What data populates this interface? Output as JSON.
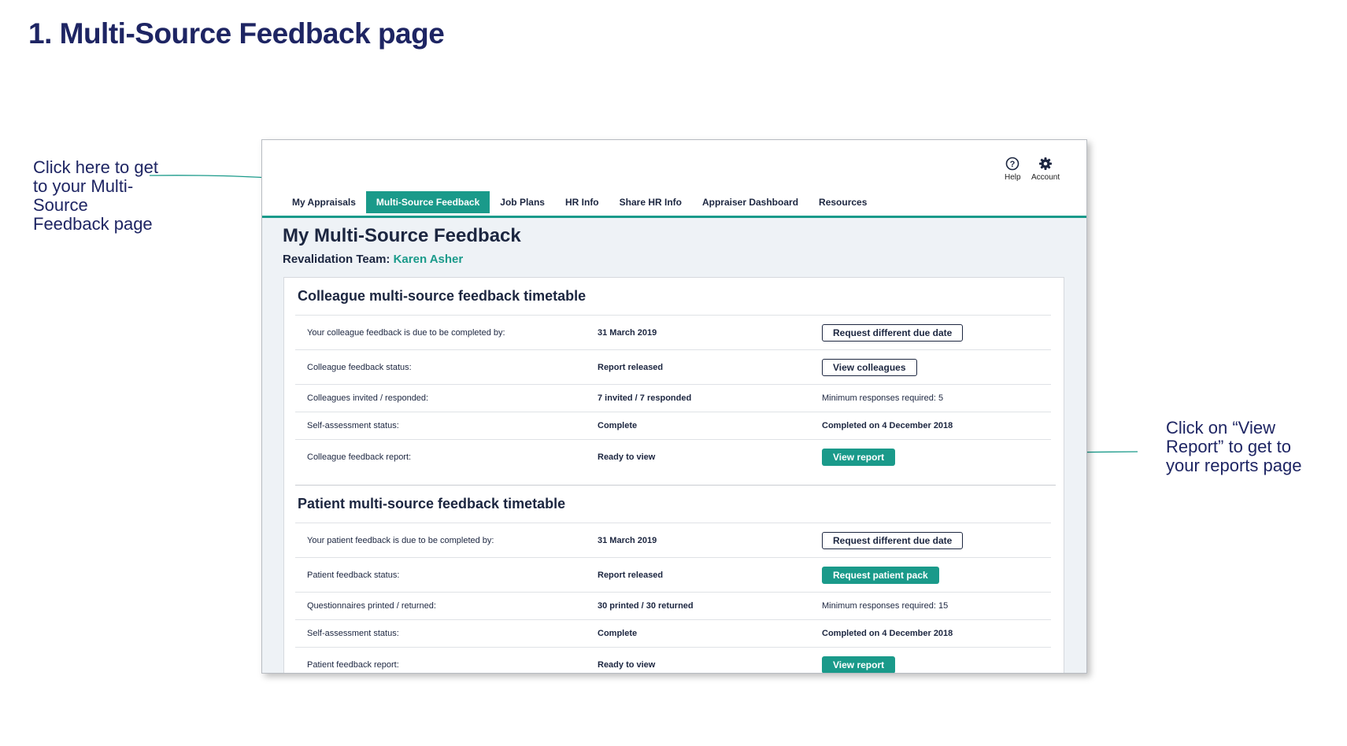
{
  "slide_title": "1. Multi-Source Feedback page",
  "annotations": {
    "left": "Click here to get to your Multi-Source Feedback page",
    "right": "Click on “View Report” to get to your reports page"
  },
  "colors": {
    "brand_teal": "#1a9a8a",
    "navy": "#1e2563"
  },
  "utility": {
    "help_label": "Help",
    "help_icon": "help-circle-icon",
    "account_label": "Account",
    "account_icon": "gear-icon"
  },
  "tabs": [
    {
      "label": "My Appraisals"
    },
    {
      "label": "Multi-Source Feedback",
      "active": true
    },
    {
      "label": "Job Plans"
    },
    {
      "label": "HR Info"
    },
    {
      "label": "Share HR Info"
    },
    {
      "label": "Appraiser Dashboard"
    },
    {
      "label": "Resources"
    }
  ],
  "page": {
    "heading": "My Multi-Source Feedback",
    "team_label": "Revalidation Team:",
    "team_name": "Karen Asher"
  },
  "colleague": {
    "heading": "Colleague multi-source feedback timetable",
    "rows": [
      {
        "label": "Your colleague feedback is due to be completed by:",
        "value": "31 March 2019",
        "action": "Request different due date"
      },
      {
        "label": "Colleague feedback status:",
        "value": "Report released",
        "action": "View colleagues"
      },
      {
        "label": "Colleagues invited / responded:",
        "value": "7 invited / 7 responded",
        "note": "Minimum responses required: 5"
      },
      {
        "label": "Self-assessment status:",
        "value": "Complete",
        "note": "Completed on 4 December 2018"
      },
      {
        "label": "Colleague feedback report:",
        "value": "Ready to view",
        "action": "View report"
      }
    ]
  },
  "patient": {
    "heading": "Patient multi-source feedback timetable",
    "rows": [
      {
        "label": "Your patient feedback is due to be completed by:",
        "value": "31 March 2019",
        "action": "Request different due date"
      },
      {
        "label": "Patient feedback status:",
        "value": "Report released",
        "action": "Request patient pack"
      },
      {
        "label": "Questionnaires printed / returned:",
        "value": "30 printed / 30 returned",
        "note": "Minimum responses required: 15"
      },
      {
        "label": "Self-assessment status:",
        "value": "Complete",
        "note": "Completed on 4 December 2018"
      },
      {
        "label": "Patient feedback report:",
        "value": "Ready to view",
        "action": "View report"
      }
    ]
  }
}
